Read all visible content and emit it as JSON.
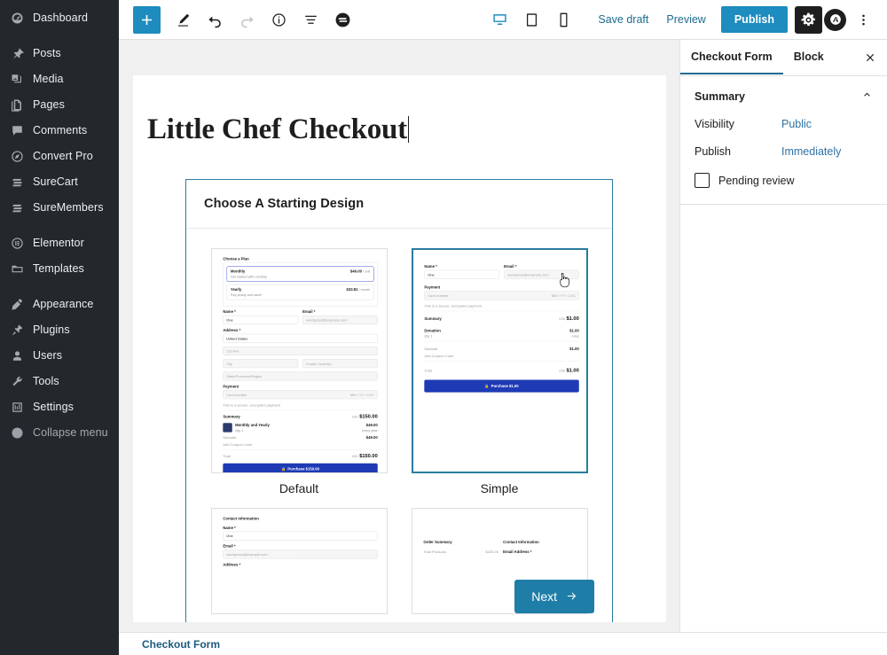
{
  "admin_menu": {
    "items": [
      {
        "label": "Dashboard",
        "icon": "dashboard-icon"
      },
      {
        "label": "Posts",
        "icon": "pin-icon"
      },
      {
        "label": "Media",
        "icon": "media-icon"
      },
      {
        "label": "Pages",
        "icon": "pages-icon"
      },
      {
        "label": "Comments",
        "icon": "comment-icon"
      },
      {
        "label": "Convert Pro",
        "icon": "compass-icon"
      },
      {
        "label": "SureCart",
        "icon": "surecart-icon"
      },
      {
        "label": "SureMembers",
        "icon": "suremembers-icon"
      },
      {
        "label": "Elementor",
        "icon": "elementor-icon"
      },
      {
        "label": "Templates",
        "icon": "folder-icon"
      },
      {
        "label": "Appearance",
        "icon": "paintbrush-icon"
      },
      {
        "label": "Plugins",
        "icon": "plugin-icon"
      },
      {
        "label": "Users",
        "icon": "user-icon"
      },
      {
        "label": "Tools",
        "icon": "wrench-icon"
      },
      {
        "label": "Settings",
        "icon": "settings-sliders-icon"
      },
      {
        "label": "Collapse menu",
        "icon": "collapse-arrow-icon"
      }
    ]
  },
  "toolbar": {
    "add_block": "+",
    "tools": [
      "edit-pencil-icon",
      "undo-icon",
      "redo-icon",
      "info-icon",
      "list-view-icon",
      "surecart-logo-icon"
    ],
    "devices": [
      "desktop-icon",
      "tablet-icon",
      "mobile-icon"
    ],
    "active_device": "desktop-icon",
    "save_draft_label": "Save draft",
    "preview_label": "Preview",
    "publish_label": "Publish",
    "settings_icon": "gear-icon",
    "astra_icon": "astra-logo-icon",
    "more_icon": "three-dots-vertical-icon",
    "accent_color": "#1e8cbe"
  },
  "editor": {
    "post_title": "Little Chef Checkout",
    "breadcrumb": "Checkout Form"
  },
  "modal": {
    "title": "Choose A Starting Design",
    "next_label": "Next",
    "border_color": "#2a7c9e",
    "next_color": "#1e7ea8",
    "designs": [
      {
        "label": "Default",
        "selected": false
      },
      {
        "label": "Simple",
        "selected": true
      },
      {
        "label": "",
        "selected": false
      },
      {
        "label": "",
        "selected": false
      }
    ]
  },
  "thumb_default": {
    "plan_heading": "Choose a Plan",
    "plan1_name": "Monthly",
    "plan1_sub": "Get started with monthly",
    "plan1_price": "$49.00",
    "plan1_per": "/ unit",
    "plan2_name": "Yearly",
    "plan2_sub": "Pay yearly and save!",
    "plan2_price": "$33.81",
    "plan2_per": "/ month",
    "name_label": "Name *",
    "name_value": "One",
    "email_label": "Email *",
    "email_value": "wordpress@example.com",
    "address_label": "Address *",
    "country_value": "United States",
    "line1_ph": "123 Ave",
    "city_ph": "City",
    "postal_ph": "Postal Code/Zip",
    "state_ph": "State/Province/Region",
    "payment_label": "Payment",
    "card_ph": "Card number",
    "card_exp": "MM / YY / CVC",
    "secure_note": "This is a secure, encrypted payment",
    "summary_label": "Summary",
    "summary_currency": "USD",
    "summary_total": "$150.00",
    "item_name": "Monthly and Yearly",
    "item_qty": "Qty 1",
    "item_price": "$49.00",
    "item_per": "every year",
    "subtotal_label": "Subtotal",
    "subtotal_value": "$49.00",
    "coupon_label": "Add Coupon Code",
    "total_label": "Total",
    "total_currency": "USD",
    "total_value": "$150.00",
    "button_label": "Purchase $150.00"
  },
  "thumb_simple": {
    "name_label": "Name *",
    "name_value": "One",
    "email_label": "Email *",
    "email_value": "wordpress@example.com",
    "payment_label": "Payment",
    "card_ph": "Card number",
    "card_exp": "MM / YY / CVC",
    "secure_note": "This is a secure, encrypted payment",
    "summary_label": "Summary",
    "summary_currency": "USD",
    "summary_total": "$1.00",
    "item_name": "Donation",
    "item_qty": "Qty 1",
    "item_price": "$1.00",
    "item_per": "once",
    "subtotal_label": "Subtotal",
    "subtotal_value": "$1.00",
    "coupon_label": "Add Coupon Code",
    "total_label": "Total",
    "total_currency": "USD",
    "total_value": "$1.00",
    "button_label": "Purchase $1.00"
  },
  "thumb_row2_left": {
    "heading": "Contact Information",
    "name_label": "Name *",
    "name_value": "One",
    "email_label": "Email *",
    "email_value": "wordpress@example.com",
    "address_label": "Address *"
  },
  "thumb_row2_right": {
    "heading_left": "Order Summary",
    "heading_right": "Contact Information",
    "row_label": "Total Products",
    "row_value": "$150.00",
    "field_label": "Email Address *"
  },
  "settings_sidebar": {
    "tab_document": "Checkout Form",
    "tab_block": "Block",
    "close_icon": "close-icon",
    "summary_title": "Summary",
    "collapse_icon": "chevron-up-icon",
    "visibility_label": "Visibility",
    "visibility_value": "Public",
    "publish_label": "Publish",
    "publish_value": "Immediately",
    "pending_review_label": "Pending review",
    "link_color": "#2e72a5"
  }
}
